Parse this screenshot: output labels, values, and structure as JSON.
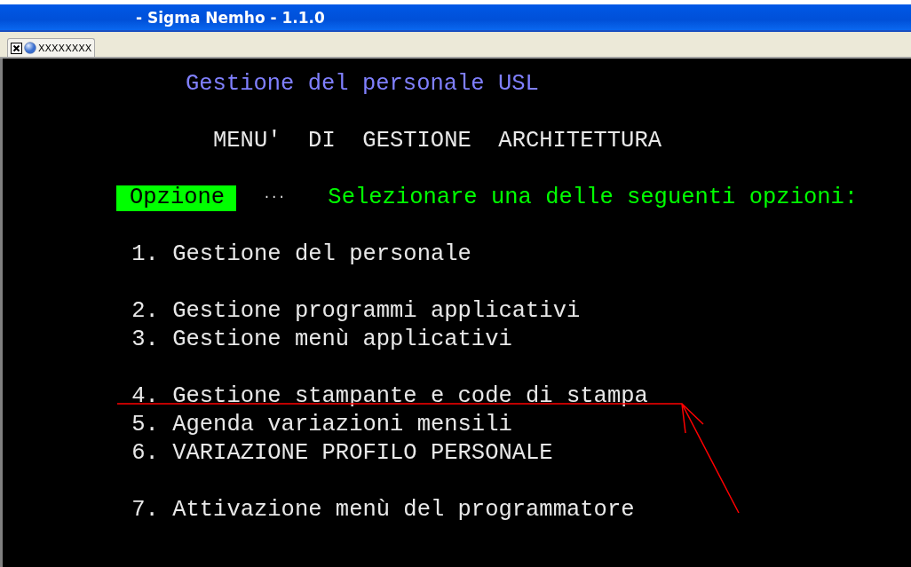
{
  "window": {
    "title": "- Sigma Nemho - 1.1.0"
  },
  "tabs": [
    {
      "label": "XXXXXXXX",
      "selected": true
    }
  ],
  "terminal": {
    "title": "Gestione del personale USL",
    "heading": "MENU'  DI  GESTIONE  ARCHITETTURA",
    "prompt": {
      "label": "Opzione",
      "dots": "...",
      "message": "Selezionare una delle seguenti opzioni:"
    },
    "option_groups": [
      [
        "1. Gestione del personale"
      ],
      [
        "2. Gestione programmi applicativi",
        "3. Gestione menù applicativi"
      ],
      [
        "4. Gestione stampante e code di stampa",
        "5. Agenda variazioni mensili",
        "6. VARIAZIONE PROFILO PERSONALE"
      ],
      [
        "7. Attivazione menù del programmatore"
      ]
    ]
  }
}
